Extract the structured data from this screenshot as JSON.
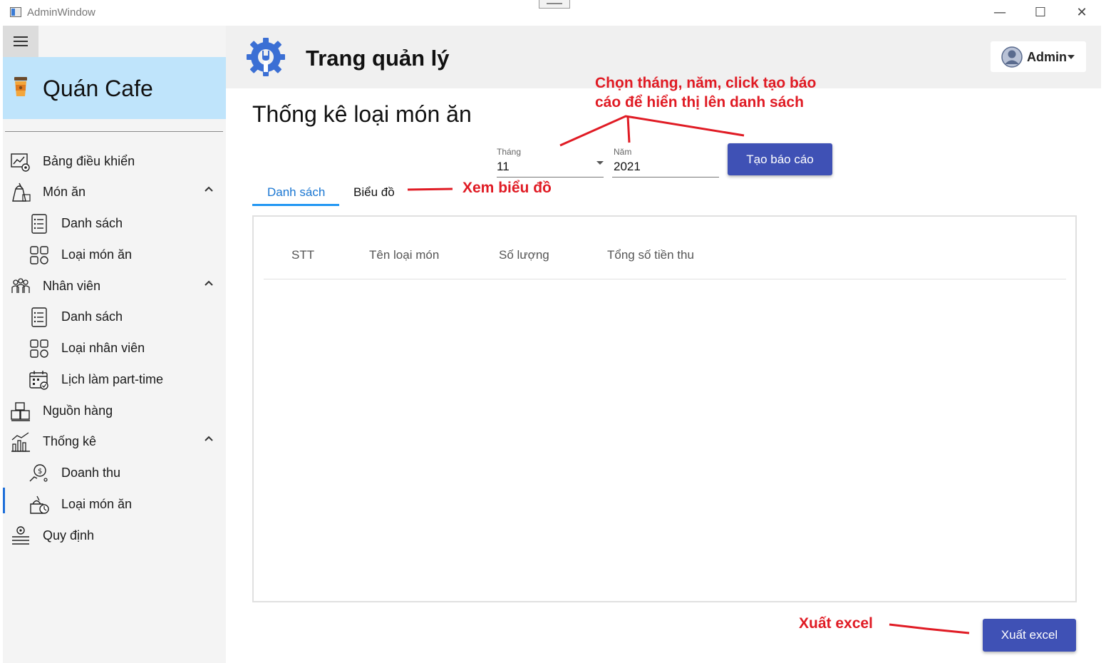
{
  "window": {
    "title": "AdminWindow",
    "controls": {
      "minimize": "—",
      "maximize": "☐",
      "close": "✕"
    }
  },
  "sidebar": {
    "brand": "Quán Cafe",
    "items": [
      {
        "label": "Bảng điều khiển",
        "icon": "dashboard-icon"
      },
      {
        "label": "Món ăn",
        "icon": "food-icon",
        "expanded": true
      },
      {
        "label": "Danh sách",
        "icon": "list-icon"
      },
      {
        "label": "Loại món ăn",
        "icon": "category-icon"
      },
      {
        "label": "Nhân viên",
        "icon": "staff-icon",
        "expanded": true
      },
      {
        "label": "Danh sách",
        "icon": "list-icon"
      },
      {
        "label": "Loại nhân viên",
        "icon": "category-icon"
      },
      {
        "label": "Lịch làm part-time",
        "icon": "calendar-icon"
      },
      {
        "label": "Nguồn hàng",
        "icon": "boxes-icon"
      },
      {
        "label": "Thống kê",
        "icon": "stats-icon",
        "expanded": true
      },
      {
        "label": "Doanh thu",
        "icon": "revenue-icon"
      },
      {
        "label": "Loại món ăn",
        "icon": "food-stats-icon",
        "active": true
      },
      {
        "label": "Quy định",
        "icon": "rules-icon"
      }
    ]
  },
  "header": {
    "title": "Trang quản lý",
    "user": "Admin"
  },
  "page": {
    "title": "Thống kê loại món ăn",
    "month": {
      "label": "Tháng",
      "value": "11"
    },
    "year": {
      "label": "Năm",
      "value": "2021"
    },
    "create_report_label": "Tạo báo cáo",
    "tabs": [
      "Danh sách",
      "Biểu đồ"
    ],
    "active_tab": 0,
    "table_columns": [
      "STT",
      "Tên loại món",
      "Số lượng",
      "Tổng số tiền thu"
    ],
    "export_label": "Xuất excel"
  },
  "annotations": {
    "report_hint": "Chọn tháng, năm, click tạo báo cáo để hiển thị lên danh sách",
    "report_hint_line1": "Chọn tháng, năm, click tạo báo",
    "report_hint_line2": "cáo để hiển thị lên danh sách",
    "chart_hint": "Xem biểu đồ",
    "export_hint": "Xuất excel"
  },
  "colors": {
    "accent": "#3f51b5",
    "tab_active": "#1976d2",
    "brand_bg": "#bfe4fb",
    "annotation": "#e01b24"
  }
}
